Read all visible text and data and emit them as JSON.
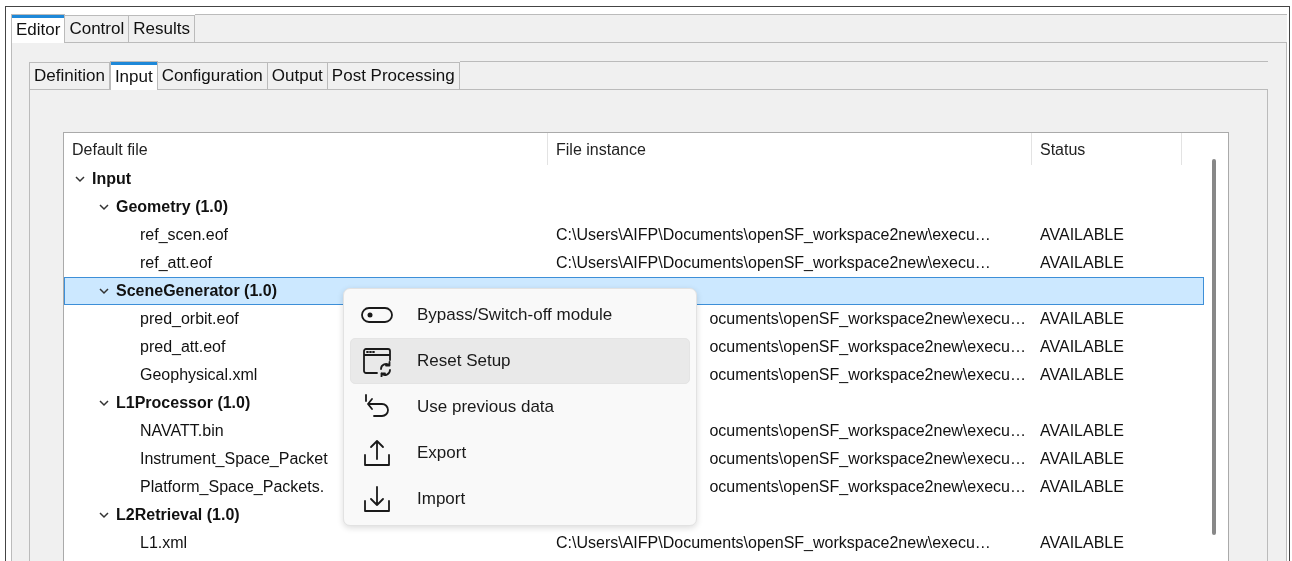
{
  "outer_tabs": [
    {
      "label": "Editor",
      "selected": true
    },
    {
      "label": "Control",
      "selected": false
    },
    {
      "label": "Results",
      "selected": false
    }
  ],
  "inner_tabs": [
    {
      "label": "Definition",
      "selected": false
    },
    {
      "label": "Input",
      "selected": true
    },
    {
      "label": "Configuration",
      "selected": false
    },
    {
      "label": "Output",
      "selected": false
    },
    {
      "label": "Post Processing",
      "selected": false
    }
  ],
  "table": {
    "columns": [
      "Default file",
      "File instance",
      "Status"
    ],
    "tree": [
      {
        "label": "Input",
        "expanded": true,
        "selected": false,
        "children": [
          {
            "label": "Geometry (1.0)",
            "expanded": true,
            "selected": false,
            "children": [
              {
                "label": "ref_scen.eof",
                "file_instance": {
                  "text": "C:\\Users\\AIFP\\Documents\\openSF_workspace2new\\execu…",
                  "covered": false
                },
                "status": "AVAILABLE"
              },
              {
                "label": "ref_att.eof",
                "file_instance": {
                  "text": "C:\\Users\\AIFP\\Documents\\openSF_workspace2new\\execu…",
                  "covered": false
                },
                "status": "AVAILABLE"
              }
            ]
          },
          {
            "label": "SceneGenerator (1.0)",
            "expanded": true,
            "selected": true,
            "children": [
              {
                "label": "pred_orbit.eof",
                "file_instance": {
                  "text": "ocuments\\openSF_workspace2new\\execu…",
                  "covered": true
                },
                "status": "AVAILABLE"
              },
              {
                "label": "pred_att.eof",
                "file_instance": {
                  "text": "ocuments\\openSF_workspace2new\\execu…",
                  "covered": true
                },
                "status": "AVAILABLE"
              },
              {
                "label": "Geophysical.xml",
                "file_instance": {
                  "text": "ocuments\\openSF_workspace2new\\execu…",
                  "covered": true
                },
                "status": "AVAILABLE"
              }
            ]
          },
          {
            "label": "L1Processor (1.0)",
            "expanded": true,
            "selected": false,
            "children": [
              {
                "label": "NAVATT.bin",
                "file_instance": {
                  "text": "ocuments\\openSF_workspace2new\\execu…",
                  "covered": true
                },
                "status": "AVAILABLE"
              },
              {
                "label": "Instrument_Space_Packet",
                "file_instance": {
                  "text": "ocuments\\openSF_workspace2new\\execu…",
                  "covered": true
                },
                "status": "AVAILABLE"
              },
              {
                "label": "Platform_Space_Packets.",
                "file_instance": {
                  "text": "ocuments\\openSF_workspace2new\\execu…",
                  "covered": true
                },
                "status": "AVAILABLE"
              }
            ]
          },
          {
            "label": "L2Retrieval (1.0)",
            "expanded": true,
            "selected": false,
            "children": [
              {
                "label": "L1.xml",
                "file_instance": {
                  "text": "C:\\Users\\AIFP\\Documents\\openSF_workspace2new\\execu…",
                  "covered": false
                },
                "status": "AVAILABLE"
              }
            ]
          }
        ]
      }
    ]
  },
  "context_menu": [
    {
      "kind": "toggle",
      "label": "Bypass/Switch-off module",
      "highlighted": false
    },
    {
      "kind": "reset",
      "label": "Reset Setup",
      "highlighted": true
    },
    {
      "kind": "undo",
      "label": "Use previous data",
      "highlighted": false
    },
    {
      "kind": "export",
      "label": "Export",
      "highlighted": false
    },
    {
      "kind": "import",
      "label": "Import",
      "highlighted": false
    }
  ]
}
